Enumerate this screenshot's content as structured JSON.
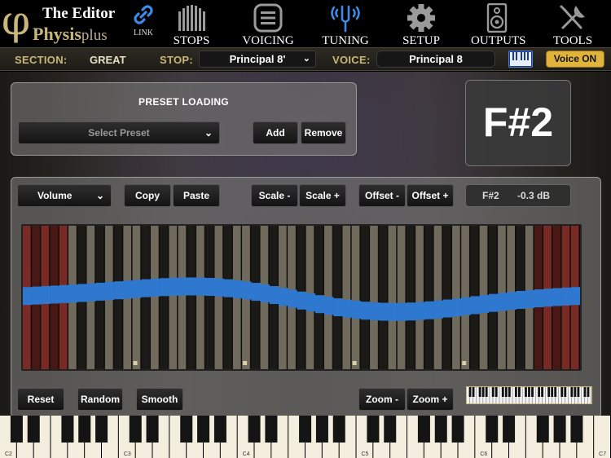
{
  "logo": {
    "line1": "The Editor",
    "line2": "Physis",
    "line2_suffix": "plus",
    "phi": "φ"
  },
  "nav": {
    "link_label": "LINK",
    "items": [
      {
        "label": "STOPS",
        "icon": "pipes-icon",
        "active": false
      },
      {
        "label": "VOICING",
        "icon": "voicing-list-icon",
        "active": false
      },
      {
        "label": "TUNING",
        "icon": "tuning-fork-icon",
        "active": true
      },
      {
        "label": "SETUP",
        "icon": "gear-icon",
        "active": false
      },
      {
        "label": "OUTPUTS",
        "icon": "speaker-icon",
        "active": false
      },
      {
        "label": "TOOLS",
        "icon": "wrench-screwdriver-icon",
        "active": false
      }
    ]
  },
  "section_bar": {
    "section_label": "SECTION:",
    "section_value": "GREAT",
    "stop_label": "STOP:",
    "stop_value": "Principal 8'",
    "voice_label": "VOICE:",
    "voice_value": "Principal 8",
    "voice_toggle": "Voice ON"
  },
  "preset": {
    "title": "PRESET LOADING",
    "select_placeholder": "Select Preset",
    "add": "Add",
    "remove": "Remove"
  },
  "current_note": "F#2",
  "editor": {
    "parameter": "Volume",
    "copy": "Copy",
    "paste": "Paste",
    "scale_minus": "Scale -",
    "scale_plus": "Scale +",
    "offset_minus": "Offset -",
    "offset_plus": "Offset +",
    "readout_note": "F#2",
    "readout_value": "-0.3 dB",
    "reset": "Reset",
    "random": "Random",
    "smooth": "Smooth",
    "zoom_minus": "Zoom -",
    "zoom_plus": "Zoom +"
  },
  "keyboard_labels": [
    "C2",
    "C3",
    "C4",
    "C5",
    "C6",
    "C7"
  ],
  "colors": {
    "accent_gold": "#c9b678",
    "curve_blue": "#2f78d0",
    "voice_on": "#e0b43c",
    "out_of_range_key": "#7a2a24"
  }
}
